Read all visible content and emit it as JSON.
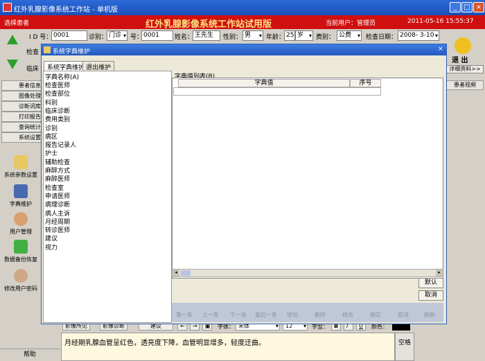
{
  "app_title": "红外乳腺影像系统工作站 - 单机版",
  "window_buttons": {
    "minimize": "_",
    "maximize": "□",
    "close": "×"
  },
  "header": {
    "select_patient": "选择患者",
    "system_name": "红外乳腺影像系统工作站试用版",
    "current_user": "当前用户：管理员",
    "datetime": "2011-05-16 15:55:37"
  },
  "patient": {
    "id_label": "I D 号：",
    "id_value": "0001",
    "visit_type_label": "诊别：",
    "visit_type_value": "门诊",
    "number_label": "号：",
    "number_value": "0001",
    "name_label": "姓名：",
    "name_value": "王先生",
    "sex_label": "性别：",
    "sex_value": "男",
    "age_label": "年龄：",
    "age_value": "25",
    "age_unit": "岁",
    "fee_label": "费别：",
    "fee_value": "公费",
    "check_date_label": "检查日期：",
    "check_date_value": "2008- 3-10"
  },
  "left_nav": {
    "partial1": "检查",
    "partial2": "临床",
    "items": [
      "患者信息",
      "图像处理",
      "诊断词库",
      "打印报告",
      "查询统计",
      "系统设置"
    ]
  },
  "tools": [
    {
      "label": "系统参数设置",
      "icon": "folder-settings-icon"
    },
    {
      "label": "字典维护",
      "icon": "book-icon"
    },
    {
      "label": "用户管理",
      "icon": "users-icon"
    },
    {
      "label": "数据备份恢复",
      "icon": "backup-icon"
    },
    {
      "label": "修改用户密码",
      "icon": "password-icon"
    }
  ],
  "right_panel": {
    "exit_label": "退  出",
    "detail_btn": "详细资料>>",
    "images_btn": "患者视频"
  },
  "dialog": {
    "title": "系统字典维护",
    "tabs": [
      "系统字典维护",
      "退出维护"
    ],
    "list_header": "字典名称(A)",
    "list_items": [
      "检查医师",
      "检查部位",
      "科别",
      "临床诊断",
      "费用类别",
      "诊别",
      "病区",
      "报告记录人",
      "护士",
      "辅助检查",
      "麻醉方式",
      "麻醉医师",
      "检查室",
      "申请医师",
      "病理诊断",
      "病人主诉",
      "月经周期",
      "转诊医师",
      "建议",
      "视力"
    ],
    "grid_caption": "字典值列表(B)",
    "grid_headers": [
      "字典值",
      "序号"
    ],
    "default_btn": "默认",
    "cancel_btn": "取消",
    "nav_buttons": [
      "第一条",
      "上一条",
      "下一条",
      "最后一条",
      "增加",
      "删除",
      "修改",
      "确定",
      "取消",
      "刷新"
    ]
  },
  "bottom_toolbar": {
    "btn1": "影像所见",
    "btn2": "影像诊断",
    "btn3": "建议",
    "font_label": "字体：",
    "font_value": "宋体",
    "size_value": "12",
    "style_label": "字型：",
    "bold": "B",
    "italic": "I",
    "underline": "U",
    "color_label": "颜色："
  },
  "text_content": "月经期乳腺血管呈红色，透亮度下降，血管明显增多，轻度迂曲。",
  "help_btn": "帮助",
  "space_btn": "空格",
  "colors": {
    "title_blue": "#1a4fb8",
    "header_red": "#d01010",
    "banner_gold": "#ffe080"
  }
}
